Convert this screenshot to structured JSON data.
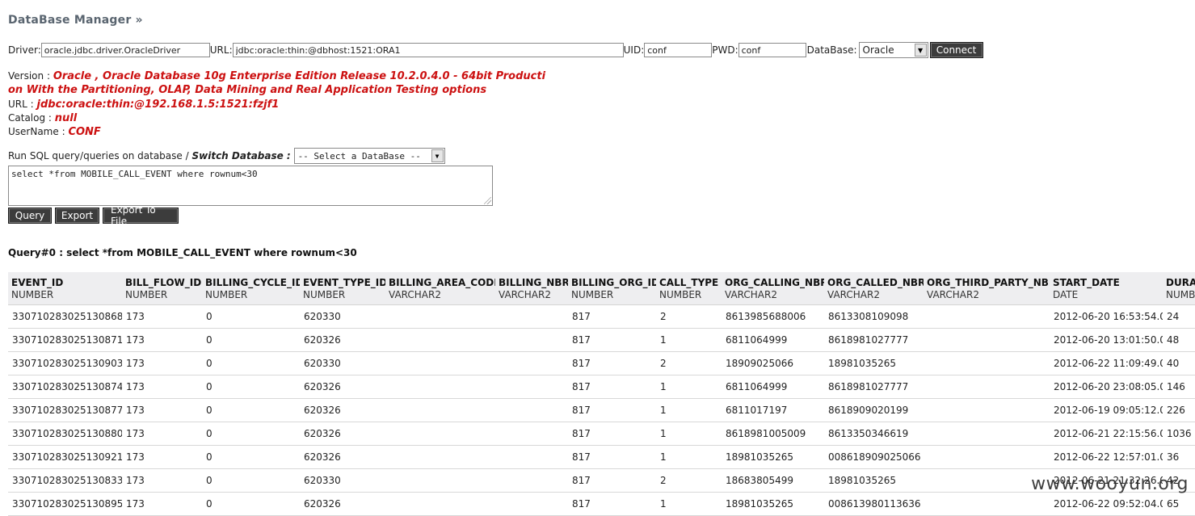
{
  "app": {
    "title": "DataBase Manager »"
  },
  "connection": {
    "driver_label": "Driver:",
    "driver_value": "oracle.jdbc.driver.OracleDriver",
    "url_label": "URL:",
    "url_value": "jdbc:oracle:thin:@dbhost:1521:ORA1",
    "uid_label": "UID:",
    "uid_value": "conf",
    "pwd_label": "PWD:",
    "pwd_value": "conf",
    "database_label": "DataBase:",
    "database_selected": "Oracle",
    "connect_label": "Connect"
  },
  "info": {
    "version_label": "Version :",
    "version_value_line1": "Oracle , Oracle Database 10g Enterprise Edition Release 10.2.0.4.0 - 64bit Producti",
    "version_value_line2": "on With the Partitioning, OLAP, Data Mining and Real Application Testing options",
    "url_label": "URL :",
    "url_value": "jdbc:oracle:thin:@192.168.1.5:1521:fzjf1",
    "catalog_label": "Catalog :",
    "catalog_value": "null",
    "username_label": "UserName :",
    "username_value": "CONF"
  },
  "query": {
    "run_label": "Run SQL query/queries on database /",
    "switch_label": "Switch Database :",
    "switch_selected": "-- Select a DataBase --",
    "sql_text": "select *from MOBILE_CALL_EVENT where rownum<30",
    "query_button": "Query",
    "export_button": "Export",
    "export_file_button": "Export To File"
  },
  "result": {
    "title": "Query#0 : select *from MOBILE_CALL_EVENT where rownum<30",
    "columns": [
      {
        "name": "EVENT_ID",
        "type": "NUMBER"
      },
      {
        "name": "BILL_FLOW_ID",
        "type": "NUMBER"
      },
      {
        "name": "BILLING_CYCLE_ID",
        "type": "NUMBER"
      },
      {
        "name": "EVENT_TYPE_ID",
        "type": "NUMBER"
      },
      {
        "name": "BILLING_AREA_CODE",
        "type": "VARCHAR2"
      },
      {
        "name": "BILLING_NBR",
        "type": "VARCHAR2"
      },
      {
        "name": "BILLING_ORG_ID",
        "type": "NUMBER"
      },
      {
        "name": "CALL_TYPE",
        "type": "NUMBER"
      },
      {
        "name": "ORG_CALLING_NBR",
        "type": "VARCHAR2"
      },
      {
        "name": "ORG_CALLED_NBR",
        "type": "VARCHAR2"
      },
      {
        "name": "ORG_THIRD_PARTY_NBR",
        "type": "VARCHAR2"
      },
      {
        "name": "START_DATE",
        "type": "DATE"
      },
      {
        "name": "DURATI",
        "type": "NUMB"
      }
    ],
    "rows": [
      [
        "330710283025130868",
        "173",
        "0",
        "620330",
        "",
        "",
        "817",
        "2",
        "8613985688006",
        "8613308109098",
        "",
        "2012-06-20 16:53:54.0",
        "24"
      ],
      [
        "330710283025130871",
        "173",
        "0",
        "620326",
        "",
        "",
        "817",
        "1",
        "6811064999",
        "8618981027777",
        "",
        "2012-06-20 13:01:50.0",
        "48"
      ],
      [
        "330710283025130903",
        "173",
        "0",
        "620330",
        "",
        "",
        "817",
        "2",
        "18909025066",
        "18981035265",
        "",
        "2012-06-22 11:09:49.0",
        "40"
      ],
      [
        "330710283025130874",
        "173",
        "0",
        "620326",
        "",
        "",
        "817",
        "1",
        "6811064999",
        "8618981027777",
        "",
        "2012-06-20 23:08:05.0",
        "146"
      ],
      [
        "330710283025130877",
        "173",
        "0",
        "620326",
        "",
        "",
        "817",
        "1",
        "6811017197",
        "8618909020199",
        "",
        "2012-06-19 09:05:12.0",
        "226"
      ],
      [
        "330710283025130880",
        "173",
        "0",
        "620326",
        "",
        "",
        "817",
        "1",
        "8618981005009",
        "8613350346619",
        "",
        "2012-06-21 22:15:56.0",
        "1036"
      ],
      [
        "330710283025130921",
        "173",
        "0",
        "620326",
        "",
        "",
        "817",
        "1",
        "18981035265",
        "008618909025066",
        "",
        "2012-06-22 12:57:01.0",
        "36"
      ],
      [
        "330710283025130833",
        "173",
        "0",
        "620330",
        "",
        "",
        "817",
        "2",
        "18683805499",
        "18981035265",
        "",
        "2012-06-21 21:32:26.0",
        "42"
      ],
      [
        "330710283025130895",
        "173",
        "0",
        "620326",
        "",
        "",
        "817",
        "1",
        "18981035265",
        "008613980113636",
        "",
        "2012-06-22 09:52:04.0",
        "65"
      ]
    ]
  },
  "watermark": "www.wooyun.org"
}
